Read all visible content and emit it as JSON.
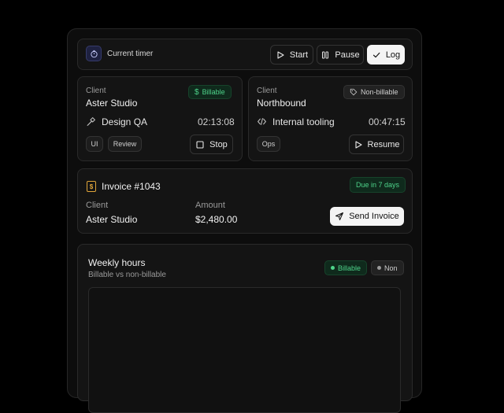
{
  "timer_bar": {
    "title": "Current timer",
    "start_label": "Start",
    "pause_label": "Pause",
    "log_label": "Log"
  },
  "client_cards": [
    {
      "client_label": "Client",
      "client_name": "Aster Studio",
      "badge": "Billable",
      "task": "Design QA",
      "time": "02:13:08",
      "tags": [
        "UI",
        "Review"
      ],
      "action": "Stop"
    },
    {
      "client_label": "Client",
      "client_name": "Northbound",
      "badge": "Non-billable",
      "task": "Internal tooling",
      "time": "00:47:15",
      "tags": [
        "Ops"
      ],
      "action": "Resume"
    }
  ],
  "invoice": {
    "title": "Invoice #1043",
    "due_badge": "Due in 7 days",
    "client_label": "Client",
    "client_value": "Aster Studio",
    "amount_label": "Amount",
    "amount_value": "$2,480.00",
    "send_label": "Send Invoice"
  },
  "weekly": {
    "title": "Weekly hours",
    "subtitle": "Billable vs non-billable",
    "legend_billable": "Billable",
    "legend_non": "Non"
  },
  "colors": {
    "accent_green": "#4ed38a",
    "badge_green_bg": "#0f2a1c",
    "timer_icon_bg": "#1e2140"
  }
}
